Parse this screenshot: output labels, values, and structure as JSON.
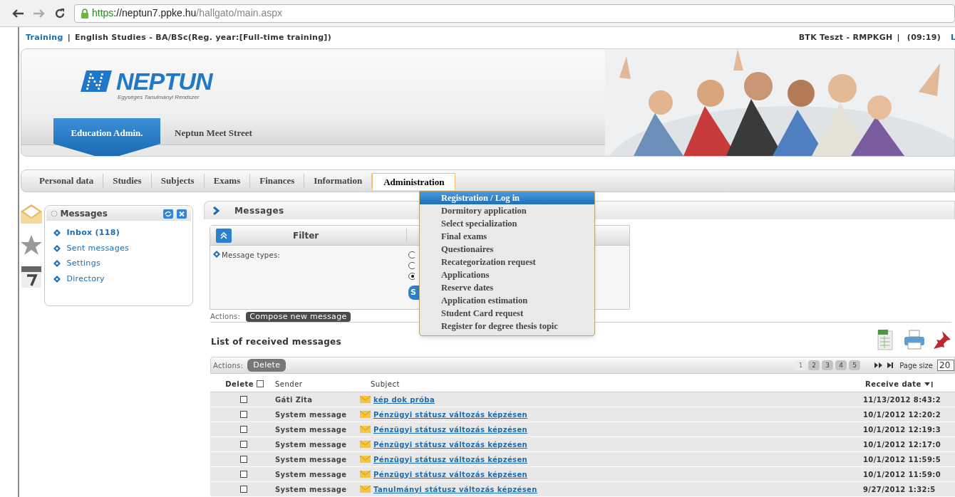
{
  "browser": {
    "url": [
      {
        "kind": "secure",
        "text": "https"
      },
      {
        "kind": "host",
        "text": "://neptun7.ppke.hu"
      },
      {
        "kind": "path",
        "text": "/hallgato/main.aspx"
      }
    ]
  },
  "top_bar": {
    "link": "Training",
    "separator": "|",
    "program": "English Studies - BA/BSc(Reg. year:[Full-time training])",
    "user": "BTK Teszt - RMPKGH",
    "separator_2": "|",
    "time": "(09:19)",
    "cut_link": "L"
  },
  "header": {
    "logo": "NEPTUN",
    "logo_subtitle": "Egységes Tanulmányi Rendszer",
    "tabs": [
      {
        "label": "Education Admin.",
        "selected": true
      },
      {
        "label": "Neptun Meet Street",
        "selected": false
      }
    ]
  },
  "menu": [
    {
      "label": "Personal data",
      "selected": false
    },
    {
      "label": "Studies",
      "selected": false
    },
    {
      "label": "Subjects",
      "selected": false
    },
    {
      "label": "Exams",
      "selected": false
    },
    {
      "label": "Finances",
      "selected": false
    },
    {
      "label": "Information",
      "selected": false
    },
    {
      "label": "Administration",
      "selected": true
    }
  ],
  "dropdown": [
    {
      "label": "Registration / Log in",
      "selected": true
    },
    {
      "label": "Dormitory application",
      "selected": false
    },
    {
      "label": "Select specialization",
      "selected": false
    },
    {
      "label": "Final exams",
      "selected": false
    },
    {
      "label": "Questionaires",
      "selected": false
    },
    {
      "label": "Recategorization request",
      "selected": false
    },
    {
      "label": "Applications",
      "selected": false
    },
    {
      "label": "Reserve dates",
      "selected": false
    },
    {
      "label": "Application estimation",
      "selected": false
    },
    {
      "label": "Student Card request",
      "selected": false
    },
    {
      "label": "Register for degree thesis topic",
      "selected": false
    }
  ],
  "sidebar": {
    "title": "Messages",
    "items": [
      {
        "label": "Inbox (118)",
        "selected": true
      },
      {
        "label": "Sent messages",
        "selected": false
      },
      {
        "label": "Settings",
        "selected": false
      },
      {
        "label": "Directory",
        "selected": false
      }
    ]
  },
  "main": {
    "title": "Messages",
    "filter": {
      "title": "Filter",
      "label": "Message types:",
      "radios": [
        {
          "selected": false
        },
        {
          "selected": false
        },
        {
          "selected": true
        }
      ],
      "button": "S"
    },
    "actions_label": "Actions:",
    "compose": "Compose new message"
  },
  "list": {
    "title": "List of received messages",
    "actions_label": "Actions:",
    "delete": "Delete",
    "pages": [
      {
        "label": "1",
        "selected": true
      },
      {
        "label": "2",
        "selected": false
      },
      {
        "label": "3",
        "selected": false
      },
      {
        "label": "4",
        "selected": false
      },
      {
        "label": "5",
        "selected": false
      }
    ],
    "page_size_label": "Page size",
    "page_size": "20",
    "columns": [
      "Delete",
      "Sender",
      "Subject",
      "Receive date"
    ],
    "all_checked": false,
    "rows": [
      {
        "checked": false,
        "sender": "Gáti Zita",
        "subject": "kép dok próba",
        "date": "11/13/2012 8:43:2"
      },
      {
        "checked": false,
        "sender": "System message",
        "subject": "Pénzügyi státusz változás képzésen",
        "date": "10/1/2012 12:20:2"
      },
      {
        "checked": false,
        "sender": "System message",
        "subject": "Pénzügyi státusz változás képzésen",
        "date": "10/1/2012 12:19:3"
      },
      {
        "checked": false,
        "sender": "System message",
        "subject": "Pénzügyi státusz változás képzésen",
        "date": "10/1/2012 12:17:0"
      },
      {
        "checked": false,
        "sender": "System message",
        "subject": "Pénzügyi státusz változás képzésen",
        "date": "10/1/2012 11:59:5"
      },
      {
        "checked": false,
        "sender": "System message",
        "subject": "Pénzügyi státusz változás képzésen",
        "date": "10/1/2012 11:59:0"
      },
      {
        "checked": false,
        "sender": "System message",
        "subject": "Tanulmányi státusz változás képzésen",
        "date": "9/27/2012 1:32:5"
      }
    ]
  }
}
